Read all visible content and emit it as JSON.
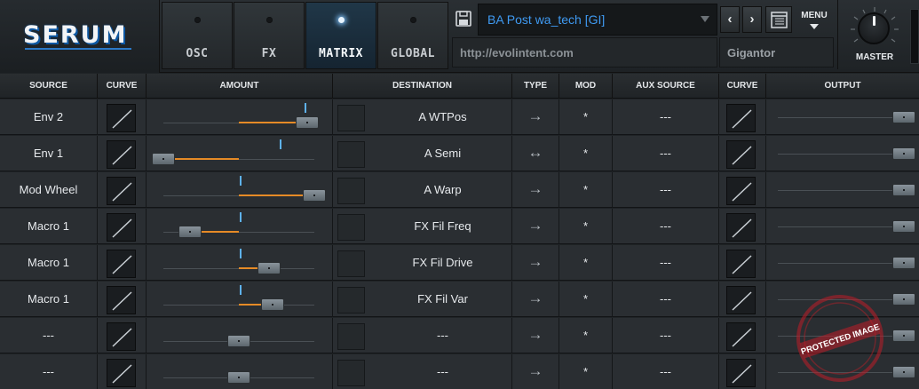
{
  "app": {
    "logo": "SERUM"
  },
  "tabs": [
    {
      "label": "OSC",
      "active": false
    },
    {
      "label": "FX",
      "active": false
    },
    {
      "label": "MATRIX",
      "active": true
    },
    {
      "label": "GLOBAL",
      "active": false
    }
  ],
  "preset": {
    "name": "BA Post wa_tech [GI]",
    "url": "http://evolintent.com",
    "author": "Gigantor"
  },
  "nav": {
    "prev": "‹",
    "next": "›",
    "menu": "MENU"
  },
  "master": {
    "label": "MASTER",
    "level": 0.5
  },
  "columns": [
    "SOURCE",
    "CURVE",
    "AMOUNT",
    "DESTINATION",
    "TYPE",
    "MOD",
    "AUX SOURCE",
    "CURVE",
    "OUTPUT"
  ],
  "rows": [
    {
      "source": "Env 2",
      "destination": "A WTPos",
      "type": "→",
      "mod": "*",
      "aux": "---",
      "amount": 0.9
    },
    {
      "source": "Env 1",
      "destination": "A Semi",
      "type": "↔",
      "mod": "*",
      "aux": "---",
      "amount": -1.0
    },
    {
      "source": "Mod Wheel",
      "destination": "A Warp",
      "type": "→",
      "mod": "*",
      "aux": "---",
      "amount": 1.0
    },
    {
      "source": "Macro 1",
      "destination": "FX Fil Freq",
      "type": "→",
      "mod": "*",
      "aux": "---",
      "amount": -0.65
    },
    {
      "source": "Macro 1",
      "destination": "FX Fil Drive",
      "type": "→",
      "mod": "*",
      "aux": "---",
      "amount": 0.4
    },
    {
      "source": "Macro 1",
      "destination": "FX Fil Var",
      "type": "→",
      "mod": "*",
      "aux": "---",
      "amount": 0.45
    },
    {
      "source": "---",
      "destination": "---",
      "type": "→",
      "mod": "*",
      "aux": "---",
      "amount": 0.0
    },
    {
      "source": "---",
      "destination": "---",
      "type": "→",
      "mod": "*",
      "aux": "---",
      "amount": 0.0
    }
  ],
  "watermark": {
    "text": "PROTECTED IMAGE"
  },
  "colors": {
    "accent": "#3f9af2",
    "amount_fill": "#e58a26",
    "indicator": "#5eb2ee",
    "stamp": "#be1e28"
  }
}
